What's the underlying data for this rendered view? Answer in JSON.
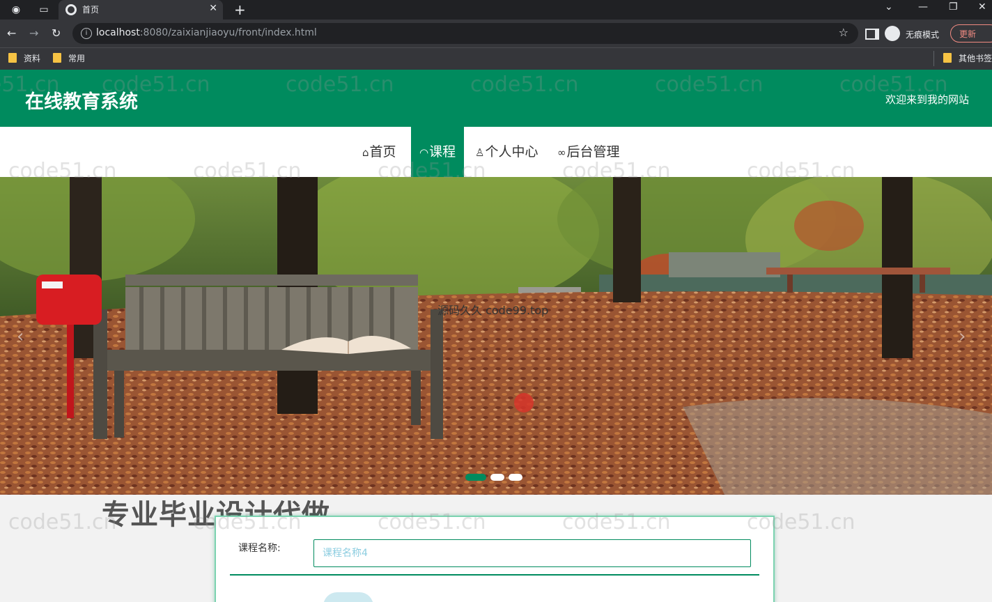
{
  "browser": {
    "tab_title": "首页",
    "url_host": "localhost",
    "url_rest": ":8080/zaixianjiaoyu/front/index.html",
    "incognito_label": "无痕模式",
    "update_label": "更新",
    "bookmarks": [
      "资料",
      "常用"
    ],
    "other_bookmarks": "其他书签"
  },
  "site": {
    "logo": "在线教育系统",
    "welcome": "欢迎来到我的网站"
  },
  "nav": [
    {
      "label": "首页",
      "icon": "home-icon",
      "glyph": "⌂"
    },
    {
      "label": "课程",
      "icon": "gauge-icon",
      "glyph": "◠"
    },
    {
      "label": "个人中心",
      "icon": "user-icon",
      "glyph": "♙"
    },
    {
      "label": "后台管理",
      "icon": "link-icon",
      "glyph": "∞"
    }
  ],
  "nav_active_index": 1,
  "banner": {
    "overlay_text": "源码久久 code99.top",
    "slide_count": 3,
    "active_slide": 1
  },
  "section": {
    "title": "专业毕业设计代做"
  },
  "search": {
    "label": "课程名称:",
    "placeholder": "课程名称4"
  },
  "watermark": "code51.cn",
  "colors": {
    "brand": "#008b5e",
    "chrome_dark": "#202124"
  }
}
